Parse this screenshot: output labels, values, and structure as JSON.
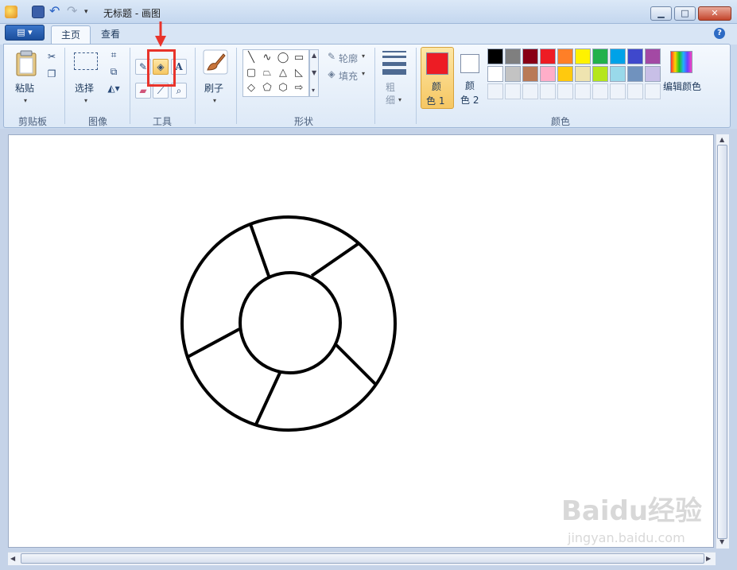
{
  "window": {
    "title": "无标题 - 画图"
  },
  "tabs": [
    {
      "label": "主页"
    },
    {
      "label": "查看"
    }
  ],
  "ribbon": {
    "clipboard": {
      "paste_label": "粘贴",
      "group_label": "剪贴板"
    },
    "image": {
      "select_label": "选择",
      "group_label": "图像"
    },
    "tools": {
      "group_label": "工具"
    },
    "brushes": {
      "label": "刷子"
    },
    "shapes": {
      "outline_label": "轮廓",
      "fill_label": "填充",
      "group_label": "形状"
    },
    "size": {
      "label": "粗细"
    },
    "colors": {
      "color1_label_top": "颜",
      "color1_label_bottom": "色 1",
      "color2_label_top": "颜",
      "color2_label_bottom": "色 2",
      "edit_label": "编辑颜色",
      "group_label": "颜色",
      "color1_value": "#ed1c24",
      "color2_value": "#ffffff",
      "palette_row1": [
        "#000000",
        "#7f7f7f",
        "#880015",
        "#ed1c24",
        "#ff7f27",
        "#fff200",
        "#22b14c",
        "#00a2e8",
        "#3f48cc",
        "#a349a4"
      ],
      "palette_row2": [
        "#ffffff",
        "#c3c3c3",
        "#b97a57",
        "#ffaec9",
        "#ffc90e",
        "#efe4b0",
        "#b5e61d",
        "#99d9ea",
        "#7092be",
        "#c8bfe7"
      ]
    }
  },
  "watermark": {
    "main": "Baidu经验",
    "sub": "jingyan.baidu.com"
  }
}
